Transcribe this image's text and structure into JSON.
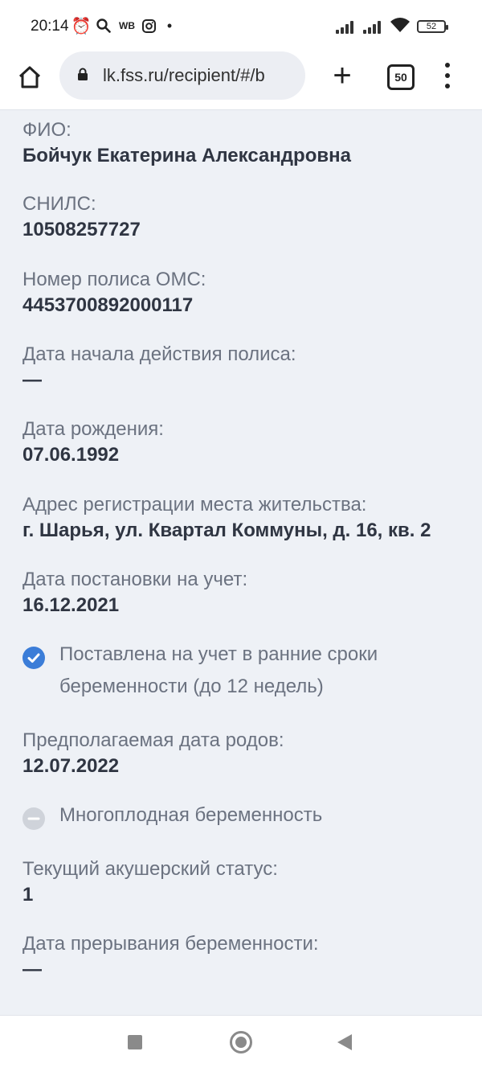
{
  "status_bar": {
    "time": "20:14",
    "wb_label": "WB",
    "battery": "52"
  },
  "browser": {
    "url": "lk.fss.ru/recipient/#/b",
    "tab_count": "50"
  },
  "fields": [
    {
      "label": "ФИО:",
      "value": "Бойчук Екатерина Александровна"
    },
    {
      "label": "СНИЛС:",
      "value": "10508257727"
    },
    {
      "label": "Номер полиса ОМС:",
      "value": "4453700892000117"
    },
    {
      "label": "Дата начала действия полиса:",
      "value": "—"
    },
    {
      "label": "Дата рождения:",
      "value": "07.06.1992"
    },
    {
      "label": "Адрес регистрации места жительства:",
      "value": "г. Шарья, ул. Квартал Коммуны, д. 16, кв. 2"
    },
    {
      "label": "Дата постановки на учет:",
      "value": "16.12.2021"
    },
    {
      "label": "Предполагаемая дата родов:",
      "value": "12.07.2022"
    },
    {
      "label": "Текущий акушерский статус:",
      "value": "1"
    },
    {
      "label": "Дата прерывания беременности:",
      "value": "—"
    }
  ],
  "checks": {
    "early_registration": {
      "text": "Поставлена на учет в ранние сроки беременности (до 12 недель)",
      "checked": true,
      "color": "#3b7dd8"
    },
    "multiple_pregnancy": {
      "text": "Многоплодная беременность",
      "checked": false,
      "color": "#cfd3da"
    }
  }
}
